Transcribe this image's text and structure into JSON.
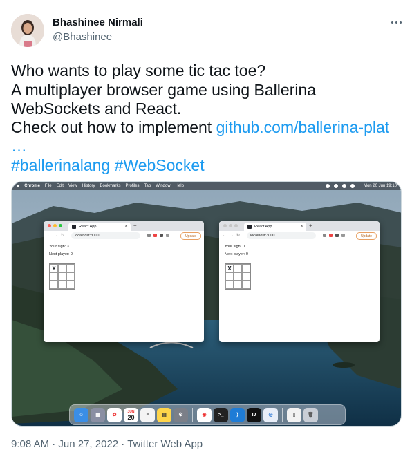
{
  "author": {
    "display_name": "Bhashinee Nirmali",
    "handle": "@Bhashinee"
  },
  "tweet": {
    "line1": "Who wants to play some tic tac toe?",
    "line2": "A multiplayer browser game using Ballerina",
    "line3": "WebSockets and React.",
    "line4_text": "Check out how to implement ",
    "link": "github.com/ballerina-plat",
    "ellipsis": "…",
    "hashtag1": "#ballerinalang",
    "hashtag2": "#WebSocket"
  },
  "screenshot": {
    "menubar": {
      "items": [
        "Chrome",
        "File",
        "Edit",
        "View",
        "History",
        "Bookmarks",
        "Profiles",
        "Tab",
        "Window",
        "Help"
      ],
      "clock": "Mon 20 Jun 19:10"
    },
    "windows": [
      {
        "tab_title": "React App",
        "url": "localhost:3000",
        "update": "Update",
        "sign": "Your sign: X",
        "next": "Next player: 0",
        "cells": [
          "X",
          "",
          "",
          "",
          "",
          "",
          "",
          "",
          ""
        ]
      },
      {
        "tab_title": "React App",
        "url": "localhost:3000",
        "update": "Update",
        "sign": "Your sign: 0",
        "next": "Next player: 0",
        "cells": [
          "X",
          "",
          "",
          "",
          "",
          "",
          "",
          "",
          ""
        ]
      }
    ],
    "dock": {
      "calendar_month": "JUN",
      "calendar_day": "20"
    }
  },
  "footer": {
    "time": "9:08 AM",
    "sep": " · ",
    "date": "Jun 27, 2022",
    "source": "Twitter Web App"
  }
}
